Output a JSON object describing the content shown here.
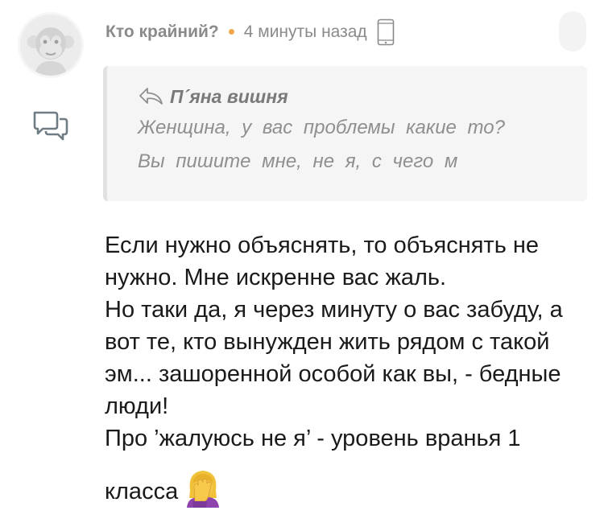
{
  "comment": {
    "author": "Кто крайний?",
    "time": "4 минуты назад",
    "quote": {
      "author": "П´яна вишня",
      "line1": "Женщина, у вас проблемы какие то?",
      "line2": "Вы пишите мне, не я, с чего м"
    },
    "body": {
      "p1": "Если нужно объяснять, то объяснять не нужно. Мне искренне вас жаль.",
      "p2": "Но таки да, я через минуту о вас забуду, а вот те, кто вынужден жить рядом с такой эм... зашоренной особой как вы, - бедные люди!",
      "p3": "Про ’жалуюсь не я’ - уровень вранья 1",
      "p4": "класса"
    }
  },
  "icons": {
    "avatar": "monkey-avatar-icon",
    "reply": "speech-bubbles-icon",
    "device": "phone-icon",
    "quote": "reply-arrow-icon",
    "emoji": "woman-facepalming-emoji"
  },
  "colors": {
    "accent_dot": "#f0a84a",
    "meta_text": "#8a8a8a",
    "quote_bg": "#f5f5f5",
    "quote_text": "#8f8f8f"
  }
}
